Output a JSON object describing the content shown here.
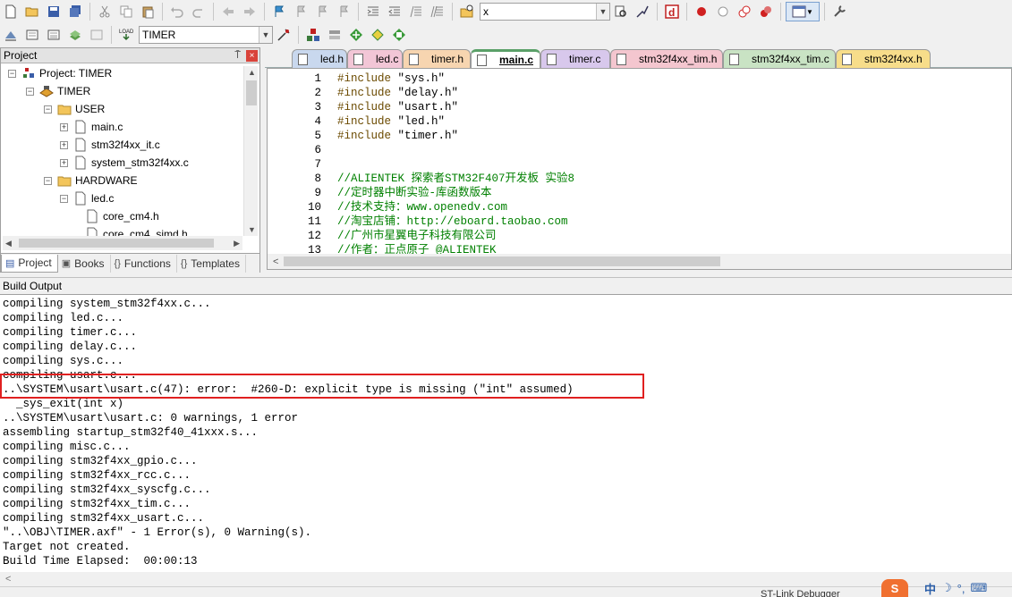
{
  "toolbar1": {
    "target_combo_value": "x"
  },
  "toolbar2": {
    "target_select_value": "TIMER"
  },
  "project": {
    "header": "Project",
    "pin": "⍑",
    "close": "×",
    "tree": [
      {
        "label": "Project: TIMER",
        "level": 0,
        "expander": "−",
        "icon": "project"
      },
      {
        "label": "TIMER",
        "level": 1,
        "expander": "−",
        "icon": "target"
      },
      {
        "label": "USER",
        "level": 2,
        "expander": "−",
        "icon": "folder"
      },
      {
        "label": "main.c",
        "level": 3,
        "expander": "+",
        "icon": "file"
      },
      {
        "label": "stm32f4xx_it.c",
        "level": 3,
        "expander": "+",
        "icon": "file"
      },
      {
        "label": "system_stm32f4xx.c",
        "level": 3,
        "expander": "+",
        "icon": "file"
      },
      {
        "label": "HARDWARE",
        "level": 2,
        "expander": "−",
        "icon": "folder"
      },
      {
        "label": "led.c",
        "level": 3,
        "expander": "−",
        "icon": "file"
      },
      {
        "label": "core_cm4.h",
        "level": 4,
        "expander": "",
        "icon": "file"
      },
      {
        "label": "core_cm4_simd.h",
        "level": 4,
        "expander": "",
        "icon": "file"
      }
    ],
    "tabs": [
      {
        "label": "Project",
        "active": true
      },
      {
        "label": "Books",
        "active": false
      },
      {
        "label": "Functions",
        "active": false
      },
      {
        "label": "Templates",
        "active": false
      }
    ]
  },
  "editor": {
    "tabs": [
      {
        "label": "led.h",
        "color": "#c9d8ee",
        "active": false
      },
      {
        "label": "led.c",
        "color": "#f2c6d6",
        "active": false
      },
      {
        "label": "timer.h",
        "color": "#f7d5b0",
        "active": false
      },
      {
        "label": "main.c",
        "color": "#bfe0c8",
        "active": true
      },
      {
        "label": "timer.c",
        "color": "#d8c8ec",
        "active": false
      },
      {
        "label": "stm32f4xx_tim.h",
        "color": "#f4c6cf",
        "active": false
      },
      {
        "label": "stm32f4xx_tim.c",
        "color": "#c9e3c4",
        "active": false
      },
      {
        "label": "stm32f4xx.h",
        "color": "#f7dd8a",
        "active": false
      }
    ],
    "lines": [
      {
        "n": "1",
        "kw": "#include",
        "rest": " \"sys.h\"",
        "type": "inc"
      },
      {
        "n": "2",
        "kw": "#include",
        "rest": " \"delay.h\"",
        "type": "inc"
      },
      {
        "n": "3",
        "kw": "#include",
        "rest": " \"usart.h\"",
        "type": "inc"
      },
      {
        "n": "4",
        "kw": "#include",
        "rest": " \"led.h\"",
        "type": "inc"
      },
      {
        "n": "5",
        "kw": "#include",
        "rest": " \"timer.h\"",
        "type": "inc"
      },
      {
        "n": "6",
        "kw": "",
        "rest": "",
        "type": "blank"
      },
      {
        "n": "7",
        "kw": "",
        "rest": "",
        "type": "blank"
      },
      {
        "n": "8",
        "kw": "",
        "rest": "//ALIENTEK 探索者STM32F407开发板 实验8",
        "type": "cm"
      },
      {
        "n": "9",
        "kw": "",
        "rest": "//定时器中断实验-库函数版本",
        "type": "cm"
      },
      {
        "n": "10",
        "kw": "",
        "rest": "//技术支持：www.openedv.com",
        "type": "cm"
      },
      {
        "n": "11",
        "kw": "",
        "rest": "//淘宝店铺：http://eboard.taobao.com",
        "type": "cm"
      },
      {
        "n": "12",
        "kw": "",
        "rest": "//广州市星翼电子科技有限公司",
        "type": "cm"
      },
      {
        "n": "13",
        "kw": "",
        "rest": "//作者：正点原子 @ALIENTEK",
        "type": "cm"
      }
    ]
  },
  "build_output": {
    "header": "Build Output",
    "lines": [
      "compiling system_stm32f4xx.c...",
      "compiling led.c...",
      "compiling timer.c...",
      "compiling delay.c...",
      "compiling sys.c...",
      "compiling usart.c...",
      "..\\SYSTEM\\usart\\usart.c(47): error:  #260-D: explicit type is missing (\"int\" assumed)",
      "  _sys_exit(int x)",
      "..\\SYSTEM\\usart\\usart.c: 0 warnings, 1 error",
      "assembling startup_stm32f40_41xxx.s...",
      "compiling misc.c...",
      "compiling stm32f4xx_gpio.c...",
      "compiling stm32f4xx_rcc.c...",
      "compiling stm32f4xx_syscfg.c...",
      "compiling stm32f4xx_tim.c...",
      "compiling stm32f4xx_usart.c...",
      "\"..\\OBJ\\TIMER.axf\" - 1 Error(s), 0 Warning(s).",
      "Target not created.",
      "Build Time Elapsed:  00:00:13"
    ],
    "scroll_left": "<"
  },
  "status": {
    "debugger": "ST-Link Debugger"
  },
  "tray": {
    "sogou": "S",
    "ime_zh": "中",
    "moon": "☽",
    "punct": "°,",
    "keyboard": "⌨"
  }
}
